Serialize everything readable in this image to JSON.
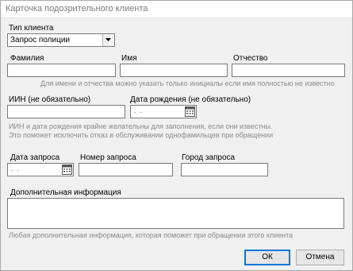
{
  "window": {
    "title": "Карточка подозрительного клиента"
  },
  "client_type": {
    "label": "Тип клиента",
    "value": "Запрос полиции"
  },
  "surname": {
    "label": "Фамилия",
    "value": ""
  },
  "name": {
    "label": "Имя",
    "value": ""
  },
  "patronymic": {
    "label": "Отчество",
    "value": ""
  },
  "initials_hint": "Для имени и отчества можно указать только инициалы если имя полностью не известно",
  "iin": {
    "label": "ИИН (не обязательно)",
    "value": ""
  },
  "birth_date": {
    "label": "Дата рождения (не обязательно)",
    "mask": ". ."
  },
  "iin_hint_1": "ИИН и дата рождения крайне желательны для заполнения, если они известны.",
  "iin_hint_2": "Это поможет исключить отказ в обслуживании однофамильцев при обращении",
  "request_date": {
    "label": "Дата запроса",
    "mask": ". ."
  },
  "request_number": {
    "label": "Номер запроса",
    "value": ""
  },
  "request_city": {
    "label": "Город запроса",
    "value": ""
  },
  "additional_info": {
    "label": "Дополнительная информация",
    "value": ""
  },
  "additional_hint": "Любая дополнительная информация, которая поможет при обращении этого клиента",
  "buttons": {
    "ok": "ОК",
    "cancel": "Отмена"
  },
  "icons": {
    "dropdown": "chevron-down-icon",
    "calendar": "calendar-icon"
  }
}
